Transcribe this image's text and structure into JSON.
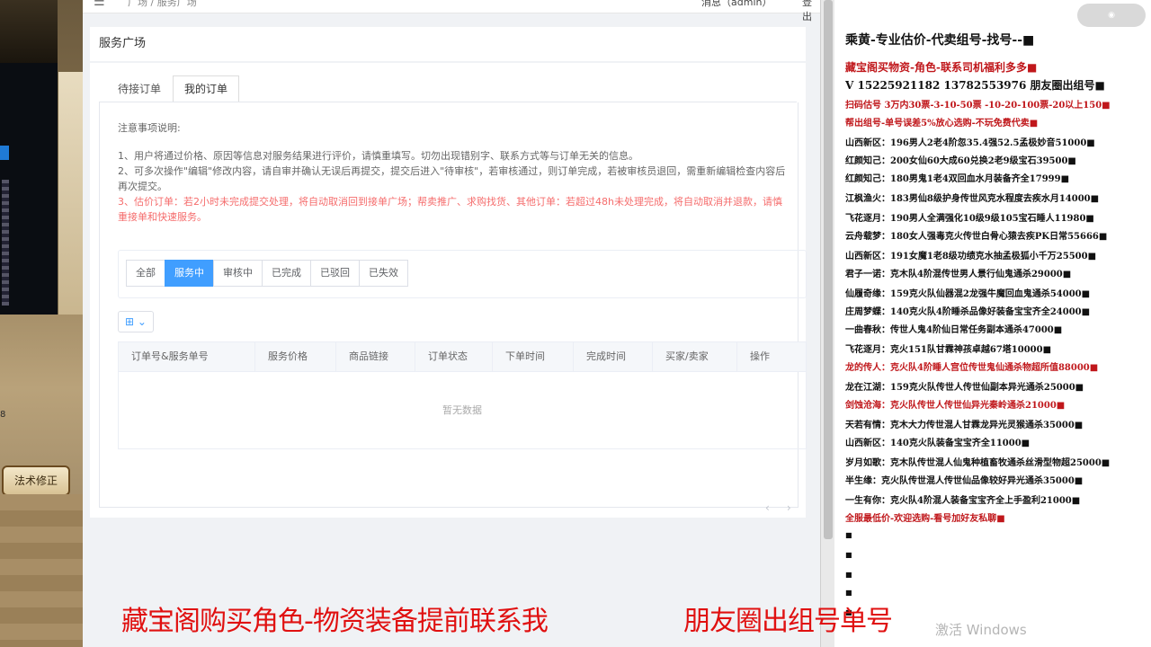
{
  "game": {
    "button_label": "法术修正",
    "counter": "8"
  },
  "topnav": {
    "menu_icon": "menu-icon",
    "breadcrumb": "广场 / 服务广场",
    "user": "消息（admin）",
    "logout": "登出"
  },
  "page_title": "服务广场",
  "tabs": [
    {
      "label": "待接订单"
    },
    {
      "label": "我的订单"
    }
  ],
  "notes": {
    "title": "注意事项说明:",
    "items": [
      "1、用户将通过价格、原因等信息对服务结果进行评价，请慎重填写。切勿出现错别字、联系方式等与订单无关的信息。",
      "2、可多次操作\"编辑\"修改内容，请自审并确认无误后再提交，提交后进入\"待审核\"，若审核通过，则订单完成，若被审核员退回，需重新编辑检查内容后再次提交。"
    ],
    "warning": "3、估价订单：若2小时未完成提交处理，将自动取消回到接单广场；帮卖推广、求购找货、其他订单：若超过48h未处理完成，将自动取消并退款，请慎重接单和快速服务。"
  },
  "filters": [
    "全部",
    "服务中",
    "审核中",
    "已完成",
    "已驳回",
    "已失效"
  ],
  "grid_toggle": "⊞ ⌄",
  "table": {
    "columns": [
      "订单号&服务单号",
      "服务价格",
      "商品链接",
      "订单状态",
      "下单时间",
      "完成时间",
      "买家/卖家",
      "操作"
    ],
    "empty_text": "暂无数据"
  },
  "pager": {
    "prev": "‹",
    "next": "›"
  },
  "side": {
    "logo": "◉",
    "lines": [
      {
        "text": "乘黄-专业估价-代卖组号-找号--■",
        "style": "big"
      },
      {
        "text": "藏宝阁买物资-角色-联系司机福利多多■",
        "style": "med red"
      },
      {
        "text": "V 15225921182   13782553976 朋友圈出组号■",
        "style": "med"
      },
      {
        "text": "扫码估号 3万内30票-3-10-50票 -10-20-100票-20以上150■",
        "style": "red"
      },
      {
        "text": "帮出组号-单号误差5%放心选购-不玩免费代卖■",
        "style": "red"
      },
      {
        "text": "山西新区：196男人2老4阶忽35.4强52.5孟极妙音51000■",
        "style": ""
      },
      {
        "text": "红颜知己：200女仙60大成60兑换2老9级宝石39500■",
        "style": ""
      },
      {
        "text": "红颜知己：180男鬼1老4双回血水月装备齐全17999■",
        "style": ""
      },
      {
        "text": "江枫渔火：183男仙8级护身传世风克水程度去疾水月14000■",
        "style": ""
      },
      {
        "text": "飞花逐月：190男人全满强化10级9级105宝石睡人11980■",
        "style": ""
      },
      {
        "text": "云舟载梦：180女人强毒克火传世白骨心猿去疾PK日常55666■",
        "style": ""
      },
      {
        "text": "山西新区：191女魔1老8级功绩克水抽孟极狐小千万25500■",
        "style": ""
      },
      {
        "text": "君子一诺：克木队4阶混传世男人景行仙鬼通杀29000■",
        "style": ""
      },
      {
        "text": "仙履奇缘：159克火队仙器混2龙强牛魔回血鬼通杀54000■",
        "style": ""
      },
      {
        "text": "庄周梦蝶：140克火队4阶睡杀品像好装备宝宝齐全24000■",
        "style": ""
      },
      {
        "text": "一曲春秋：传世人鬼4阶仙日常任务副本通杀47000■",
        "style": ""
      },
      {
        "text": "飞花逐月：克火151队甘霖神孩卓越67塔10000■",
        "style": ""
      },
      {
        "text": "龙的传人：克火队4阶睡人宫位传世鬼仙通杀物超所值88000■",
        "style": "red"
      },
      {
        "text": "龙在江湖：159克火队传世人传世仙副本异光通杀25000■",
        "style": ""
      },
      {
        "text": "剑蚀沧海：克火队传世人传世仙异光秦岭通杀21000■",
        "style": "red"
      },
      {
        "text": "天若有情：克木大力传世混人甘霖龙异光灵猴通杀35000■",
        "style": ""
      },
      {
        "text": "山西新区：140克火队装备宝宝齐全11000■",
        "style": ""
      },
      {
        "text": "岁月如歌：克木队传世混人仙鬼种植畜牧通杀丝滑型物超25000■",
        "style": ""
      },
      {
        "text": "半生缘：克火队传世混人传世仙品像较好异光通杀35000■",
        "style": ""
      },
      {
        "text": "一生有你：克火队4阶混人装备宝宝齐全上手盈利21000■",
        "style": ""
      },
      {
        "text": "全服最低价-欢迎选购-看号加好友私聊■",
        "style": "red"
      },
      {
        "text": "■",
        "style": "sq"
      },
      {
        "text": "■",
        "style": "sq"
      },
      {
        "text": "■",
        "style": "sq"
      },
      {
        "text": "■",
        "style": "sq"
      },
      {
        "text": "■",
        "style": "sq"
      }
    ]
  },
  "watermark": "激活 Windows",
  "caption": {
    "left": "藏宝阁购买角色-物资装备提前联系我",
    "right": "朋友圈出组号单号"
  }
}
